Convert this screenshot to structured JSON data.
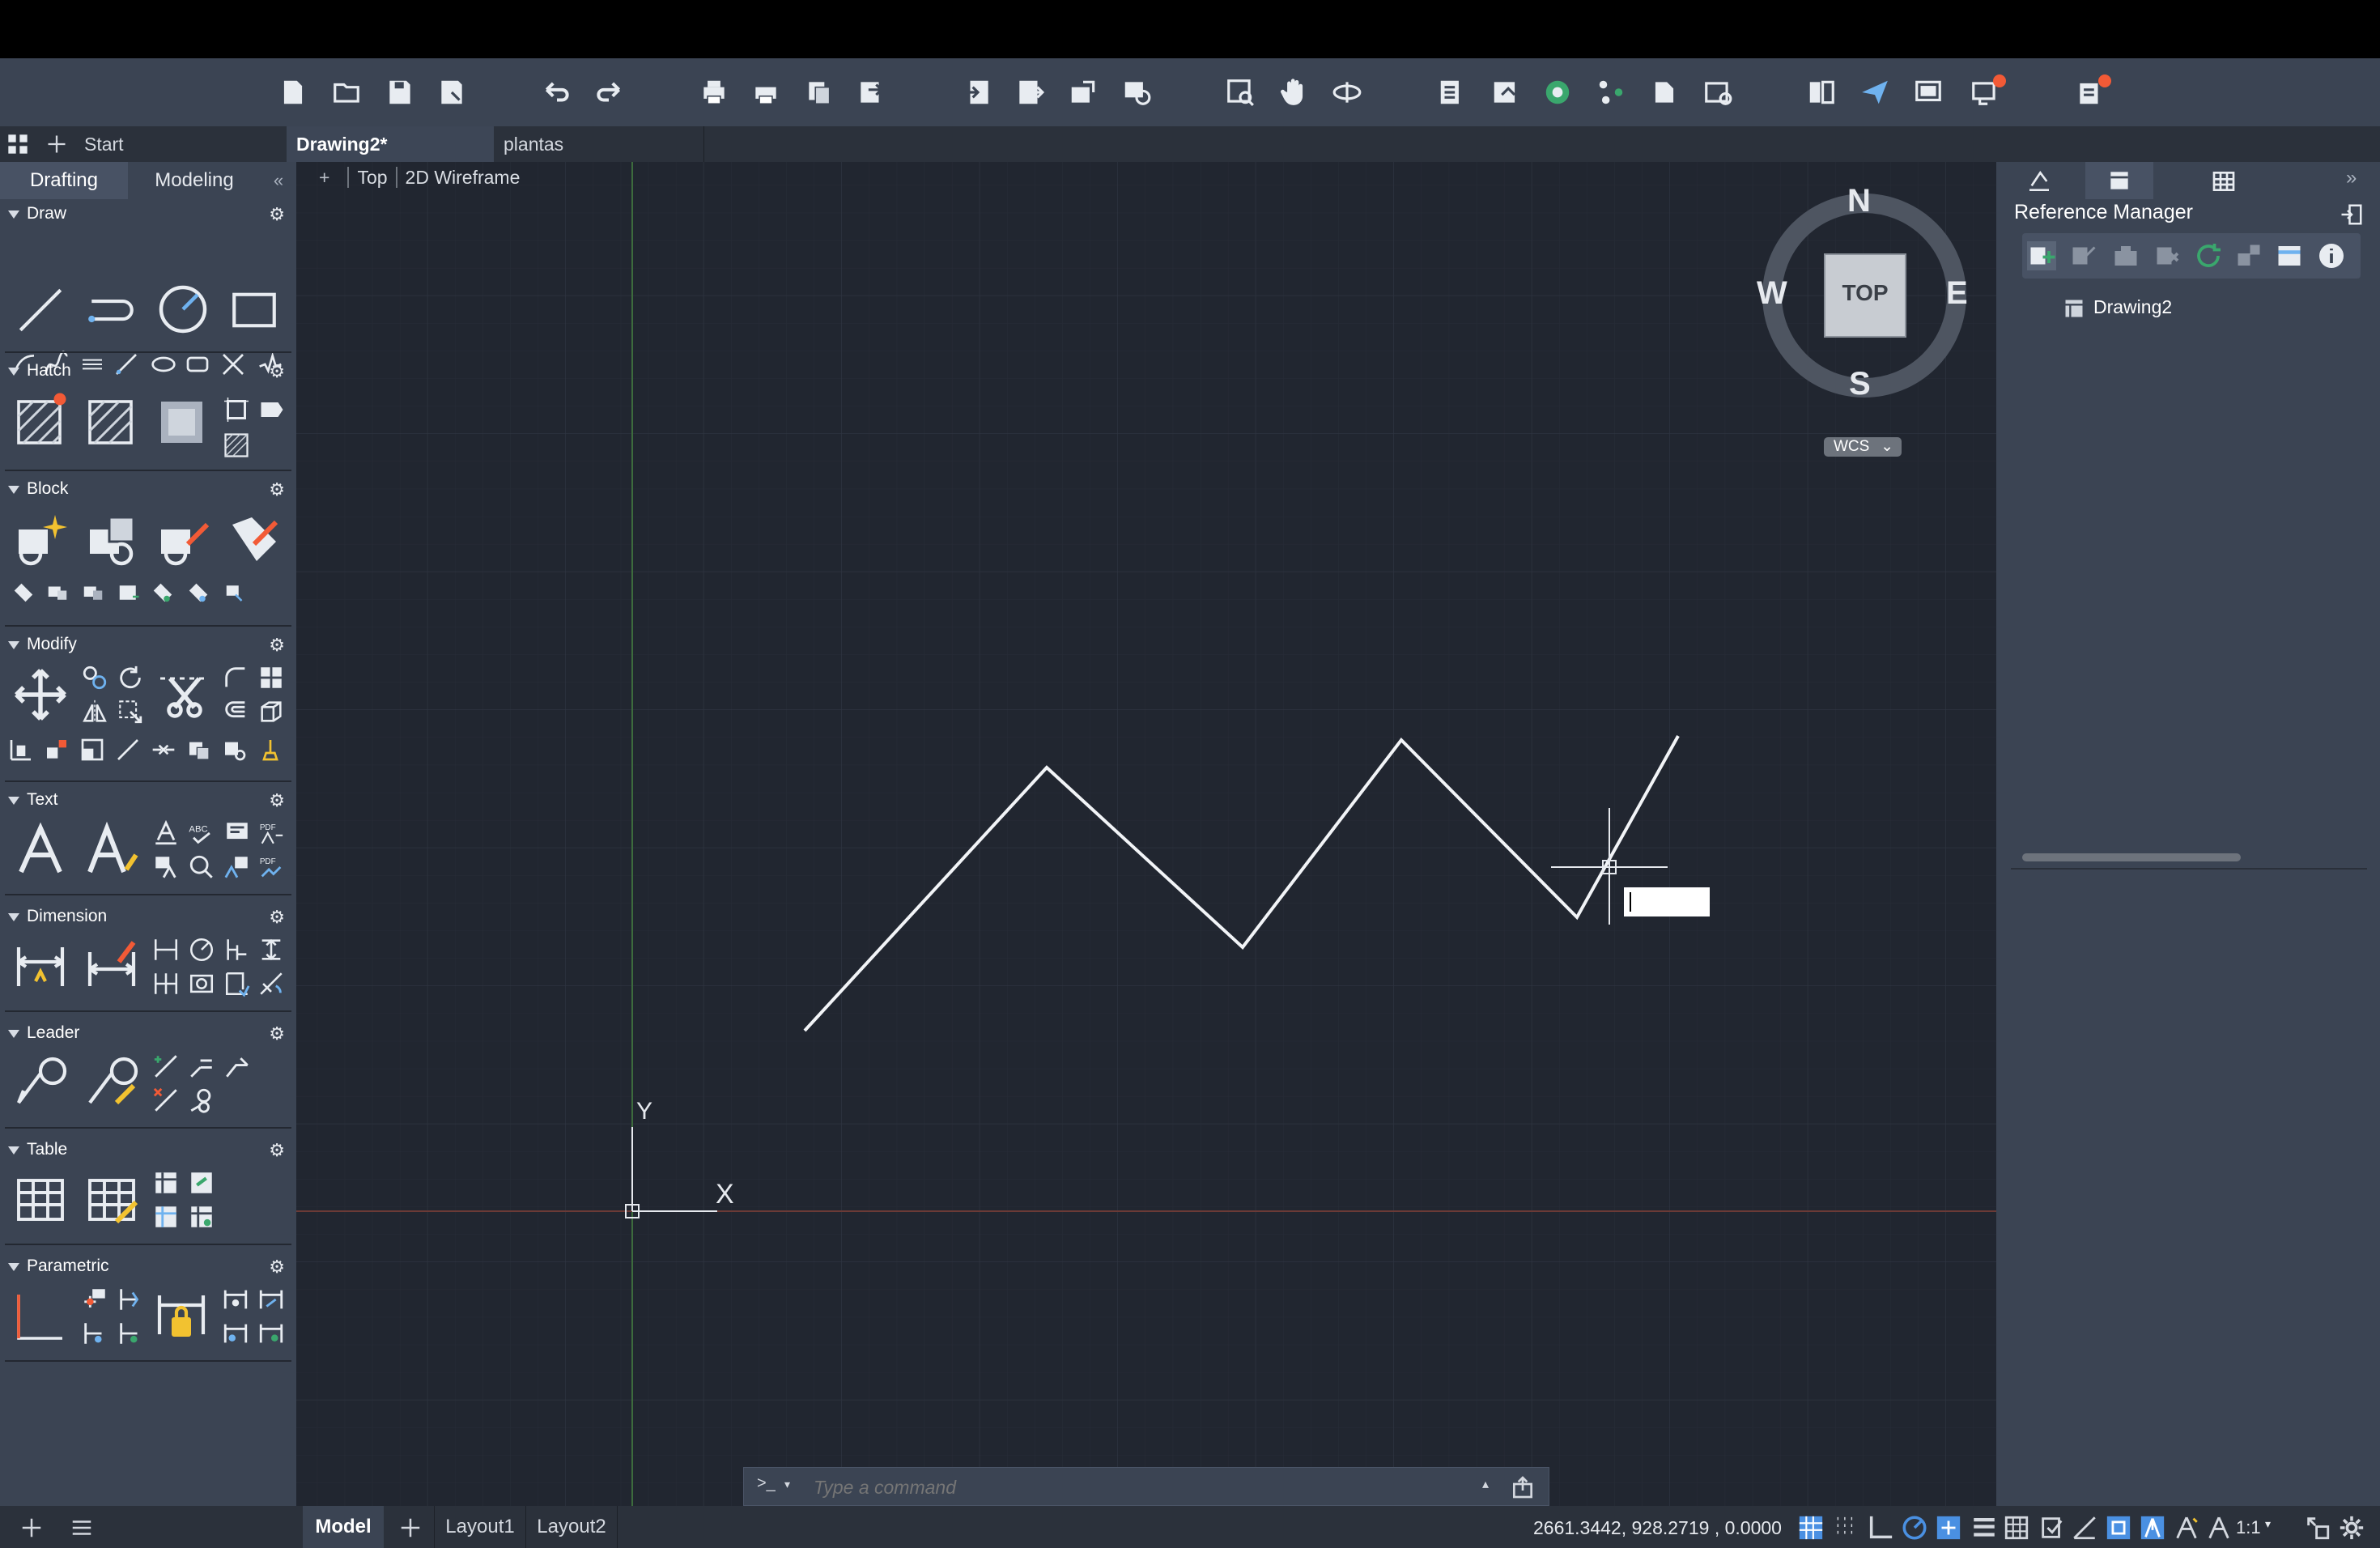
{
  "document_tabs": [
    {
      "label": "Start",
      "active": false
    },
    {
      "label": "Drawing2*",
      "active": true
    },
    {
      "label": "plantas",
      "active": false
    }
  ],
  "panel_tabs": {
    "drafting": "Drafting",
    "modeling": "Modeling"
  },
  "sections": {
    "draw": "Draw",
    "hatch": "Hatch",
    "block": "Block",
    "modify": "Modify",
    "text": "Text",
    "dimension": "Dimension",
    "leader": "Leader",
    "table": "Table",
    "parametric": "Parametric"
  },
  "viewport": {
    "plus": "+",
    "view": "Top",
    "style": "2D Wireframe"
  },
  "viewcube": {
    "north": "N",
    "south": "S",
    "east": "E",
    "west": "W",
    "face": "TOP",
    "ucs": "WCS"
  },
  "ucs_icon": {
    "x": "X",
    "y": "Y"
  },
  "reference_manager": {
    "title": "Reference Manager",
    "tree_item": "Drawing2"
  },
  "command_line": {
    "prompt": ">_",
    "placeholder": "Type a command"
  },
  "layout_tabs": [
    {
      "label": "Model",
      "active": true
    },
    {
      "label": "Layout1",
      "active": false
    },
    {
      "label": "Layout2",
      "active": false
    }
  ],
  "status": {
    "coordinates": "2661.3442, 928.2719 , 0.0000",
    "scale": "1:1"
  },
  "colors": {
    "accent": "#4a90e2",
    "notify": "#f25a36",
    "canvas": "#212630",
    "panel": "#3b4453"
  }
}
